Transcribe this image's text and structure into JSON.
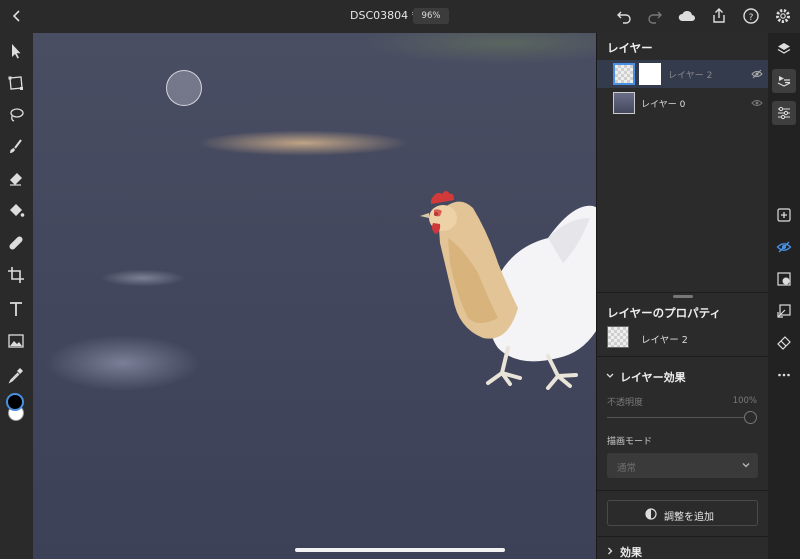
{
  "topbar": {
    "document_title": "DSC03804 *",
    "zoom_level": "96%",
    "icons": [
      "back-icon",
      "undo-icon",
      "redo-icon",
      "cloud-icon",
      "share-icon",
      "help-icon",
      "settings-icon"
    ]
  },
  "tools": [
    "select-icon",
    "transform-icon",
    "lasso-icon",
    "brush-icon",
    "eraser-icon",
    "fill-icon",
    "healing-icon",
    "crop-icon",
    "text-icon",
    "image-icon",
    "eyedropper-icon"
  ],
  "colors": {
    "foreground": "#000000",
    "background": "#ffffff",
    "accent": "#4a90e2",
    "canvas": "#464a60"
  },
  "layers_panel": {
    "title": "レイヤー",
    "layers": [
      {
        "name": "レイヤー 2",
        "selected": true,
        "visible": false
      },
      {
        "name": "レイヤー 0",
        "selected": false,
        "visible": true
      }
    ]
  },
  "properties": {
    "title": "レイヤーのプロパティ",
    "layer_name": "レイヤー 2",
    "effects_title": "レイヤー効果",
    "opacity_label": "不透明度",
    "opacity_value": "100%",
    "blend_label": "描画モード",
    "blend_value": "通常",
    "add_adjustment_label": "調整を追加",
    "effects_label": "効果"
  },
  "siderail": [
    "layers-icon",
    "layer-properties-icon",
    "adjustments-icon",
    "add-layer-icon",
    "visibility-icon",
    "mask-icon",
    "import-icon",
    "eraser-layer-icon",
    "more-icon"
  ]
}
